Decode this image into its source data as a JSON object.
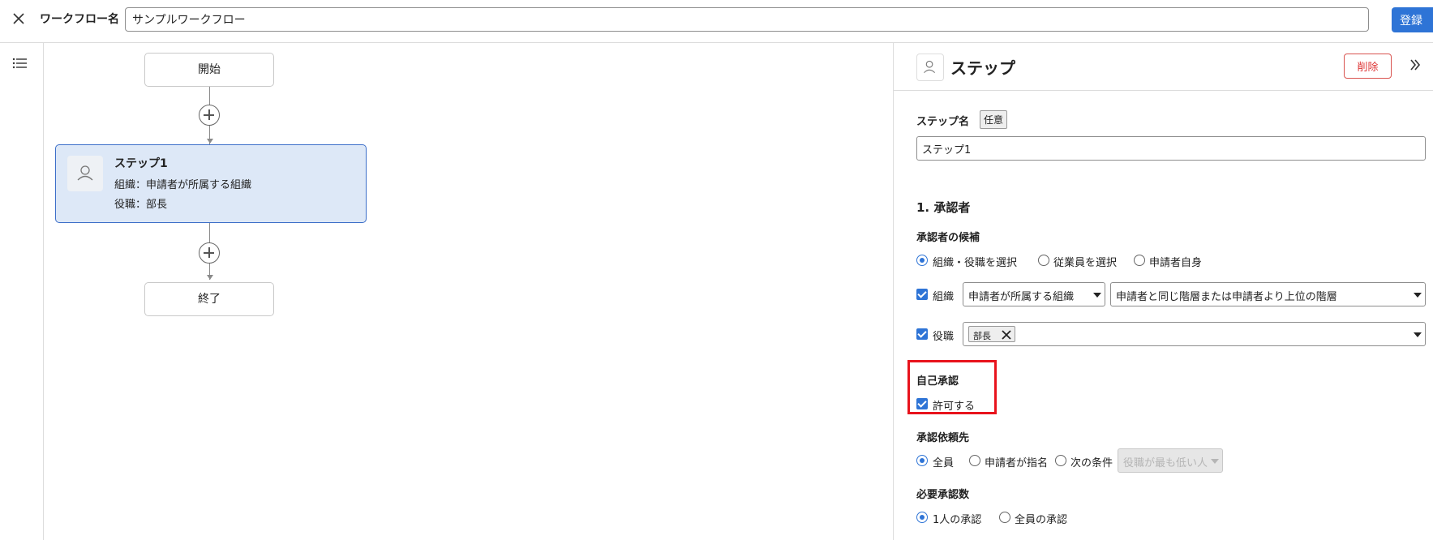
{
  "header": {
    "workflow_name_label": "ワークフロー名",
    "workflow_name_value": "サンプルワークフロー",
    "register_label": "登録"
  },
  "canvas": {
    "start_label": "開始",
    "end_label": "終了",
    "step": {
      "title": "ステップ1",
      "org_line": "組織：申請者が所属する組織",
      "role_line": "役職：部長"
    }
  },
  "panel": {
    "title": "ステップ",
    "delete_label": "削除",
    "step_name_label": "ステップ名",
    "optional_badge": "任意",
    "step_name_value": "ステップ1",
    "approver_section": "1. 承認者",
    "candidates_label": "承認者の候補",
    "candidate_options": [
      "組織・役職を選択",
      "従業員を選択",
      "申請者自身"
    ],
    "org_label": "組織",
    "org_select_value": "申請者が所属する組織",
    "hierarchy_select_value": "申請者と同じ階層または申請者より上位の階層",
    "role_label": "役職",
    "role_chip": "部長",
    "self_approval_label": "自己承認",
    "self_approval_option": "許可する",
    "request_to_label": "承認依頼先",
    "request_to_options": [
      "全員",
      "申請者が指名",
      "次の条件"
    ],
    "condition_select_value": "役職が最も低い人",
    "required_count_label": "必要承認数",
    "required_count_options": [
      "1人の承認",
      "全員の承認"
    ]
  },
  "colors": {
    "accent": "#2e74d6",
    "step_card_bg": "#dde8f7",
    "highlight": "#e8131c",
    "delete": "#d33"
  },
  "icons": {
    "close": "close-icon",
    "list": "list-icon",
    "user": "user-icon",
    "collapse": "double-chevron-right-icon"
  }
}
